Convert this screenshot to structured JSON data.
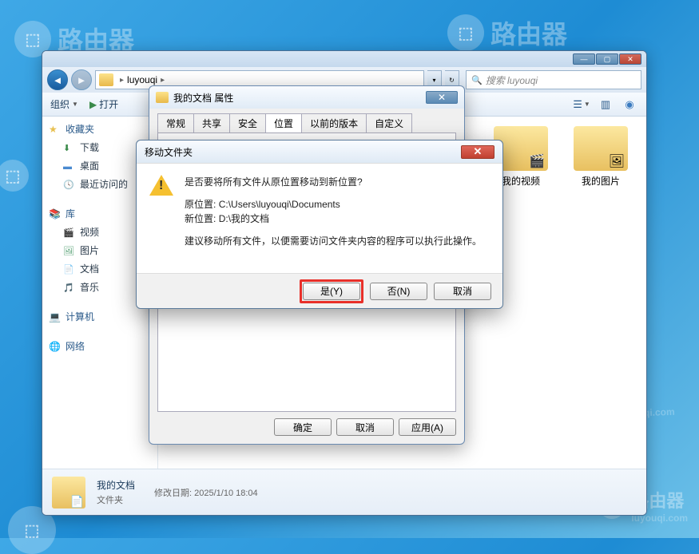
{
  "watermark": {
    "text": "路由器",
    "sub": "luyouqi.com"
  },
  "explorer": {
    "breadcrumb": {
      "folder": "luyouqi"
    },
    "search": {
      "placeholder": "搜索 luyouqi"
    },
    "toolbar": {
      "organize": "组织",
      "open": "打开"
    },
    "sidebar": {
      "favorites": "收藏夹",
      "downloads": "下载",
      "desktop": "桌面",
      "recent": "最近访问的",
      "libraries": "库",
      "videos": "视频",
      "pictures": "图片",
      "documents": "文档",
      "music": "音乐",
      "computer": "计算机",
      "network": "网络"
    },
    "files": {
      "myVideos": "我的视频",
      "myPictures": "我的图片"
    },
    "details": {
      "name": "我的文档",
      "type": "文件夹",
      "modLabel": "修改日期:",
      "modValue": "2025/1/10 18:04"
    }
  },
  "props": {
    "title": "我的文档 属性",
    "tabs": {
      "general": "常规",
      "sharing": "共享",
      "security": "安全",
      "location": "位置",
      "prev": "以前的版本",
      "custom": "自定义"
    },
    "ok": "确定",
    "cancel": "取消",
    "apply": "应用(A)"
  },
  "move": {
    "title": "移动文件夹",
    "question": "是否要将所有文件从原位置移动到新位置?",
    "origLabel": "原位置:",
    "origPath": "C:\\Users\\luyouqi\\Documents",
    "newLabel": "新位置:",
    "newPath": "D:\\我的文档",
    "advice": "建议移动所有文件，以便需要访问文件夹内容的程序可以执行此操作。",
    "yes": "是(Y)",
    "no": "否(N)",
    "cancel": "取消"
  }
}
